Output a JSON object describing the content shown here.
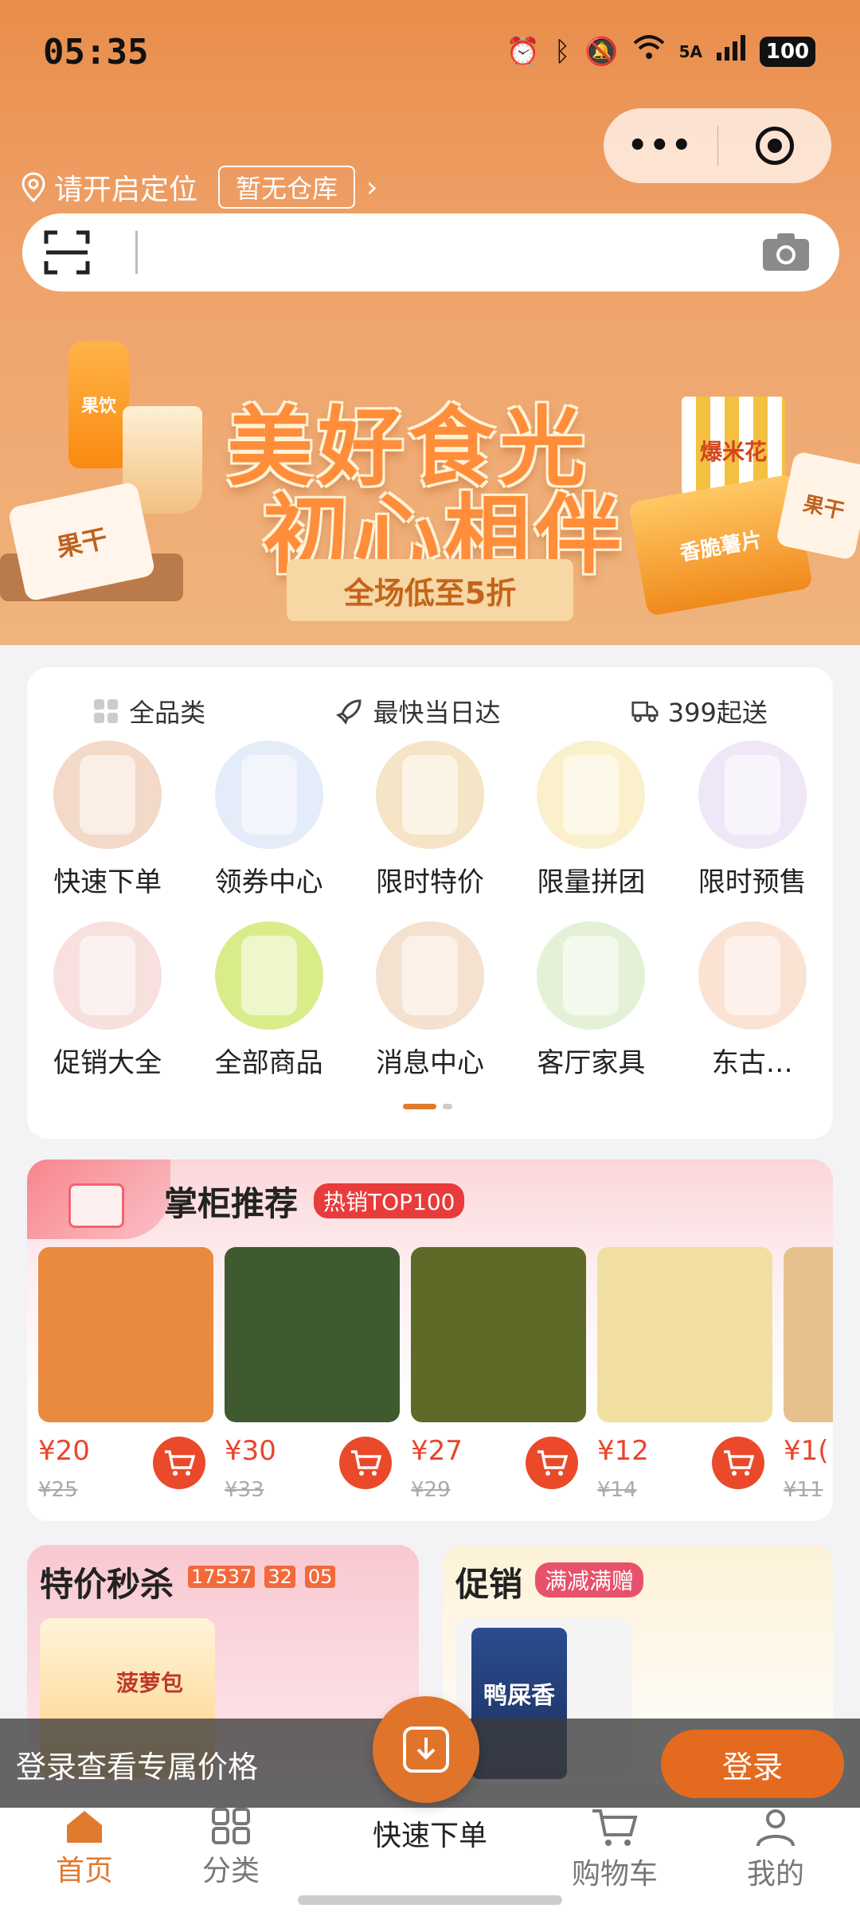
{
  "status_bar": {
    "time": "05:35",
    "network_label": "5A",
    "battery": "100"
  },
  "header": {
    "location_text": "请开启定位",
    "warehouse_label": "暂无仓库",
    "search_placeholder": ""
  },
  "banner": {
    "title_line1": "美好食光",
    "title_line2": "初心相伴",
    "ribbon": "全场低至5折",
    "product_labels": [
      "果饮",
      "果干",
      "爆米花",
      "香脆薯片",
      "果干"
    ]
  },
  "features": [
    {
      "icon": "grid-icon",
      "label": "全品类"
    },
    {
      "icon": "rocket-icon",
      "label": "最快当日达"
    },
    {
      "icon": "truck-icon",
      "label": "399起送"
    }
  ],
  "categories": [
    {
      "label": "快速下单",
      "color": "#f3d9c8"
    },
    {
      "label": "领券中心",
      "color": "#e3ecf8"
    },
    {
      "label": "限时特价",
      "color": "#f5e4c5"
    },
    {
      "label": "限量拼团",
      "color": "#fbf0cc"
    },
    {
      "label": "限时预售",
      "color": "#efe6f7"
    },
    {
      "label": "促销大全",
      "color": "#f8e0df"
    },
    {
      "label": "全部商品",
      "color": "#d9ec8a"
    },
    {
      "label": "消息中心",
      "color": "#f5e1cf"
    },
    {
      "label": "客厅家具",
      "color": "#e4f1d6"
    },
    {
      "label": "东古…",
      "color": "#fbe3d3"
    }
  ],
  "recommend": {
    "title": "掌柜推荐",
    "tag": "热销TOP100",
    "products": [
      {
        "price": "¥20",
        "original": "¥25",
        "color": "#e98a3f"
      },
      {
        "price": "¥30",
        "original": "¥33",
        "color": "#3f5a2f"
      },
      {
        "price": "¥27",
        "original": "¥29",
        "color": "#5e6a27"
      },
      {
        "price": "¥12",
        "original": "¥14",
        "color": "#f1dfa2"
      },
      {
        "price": "¥1(",
        "original": "¥11",
        "color": "#e6c18e"
      }
    ]
  },
  "flash_sale": {
    "title": "特价秒杀",
    "countdown": [
      "17537",
      "32",
      "05"
    ],
    "product_label": "菠萝包"
  },
  "promo": {
    "title": "促销",
    "tag": "满减满赠",
    "product_label": "鸭屎香"
  },
  "login_bar": {
    "text": "登录查看专属价格",
    "button": "登录"
  },
  "tabbar": {
    "items": [
      {
        "label": "首页",
        "icon": "home-icon"
      },
      {
        "label": "分类",
        "icon": "category-icon"
      },
      {
        "label": "快速下单",
        "icon": "download-icon"
      },
      {
        "label": "购物车",
        "icon": "cart-icon"
      },
      {
        "label": "我的",
        "icon": "user-icon"
      }
    ]
  },
  "colors": {
    "accent": "#e07a2f",
    "price": "#e8452c",
    "header": "#e98d4b"
  }
}
